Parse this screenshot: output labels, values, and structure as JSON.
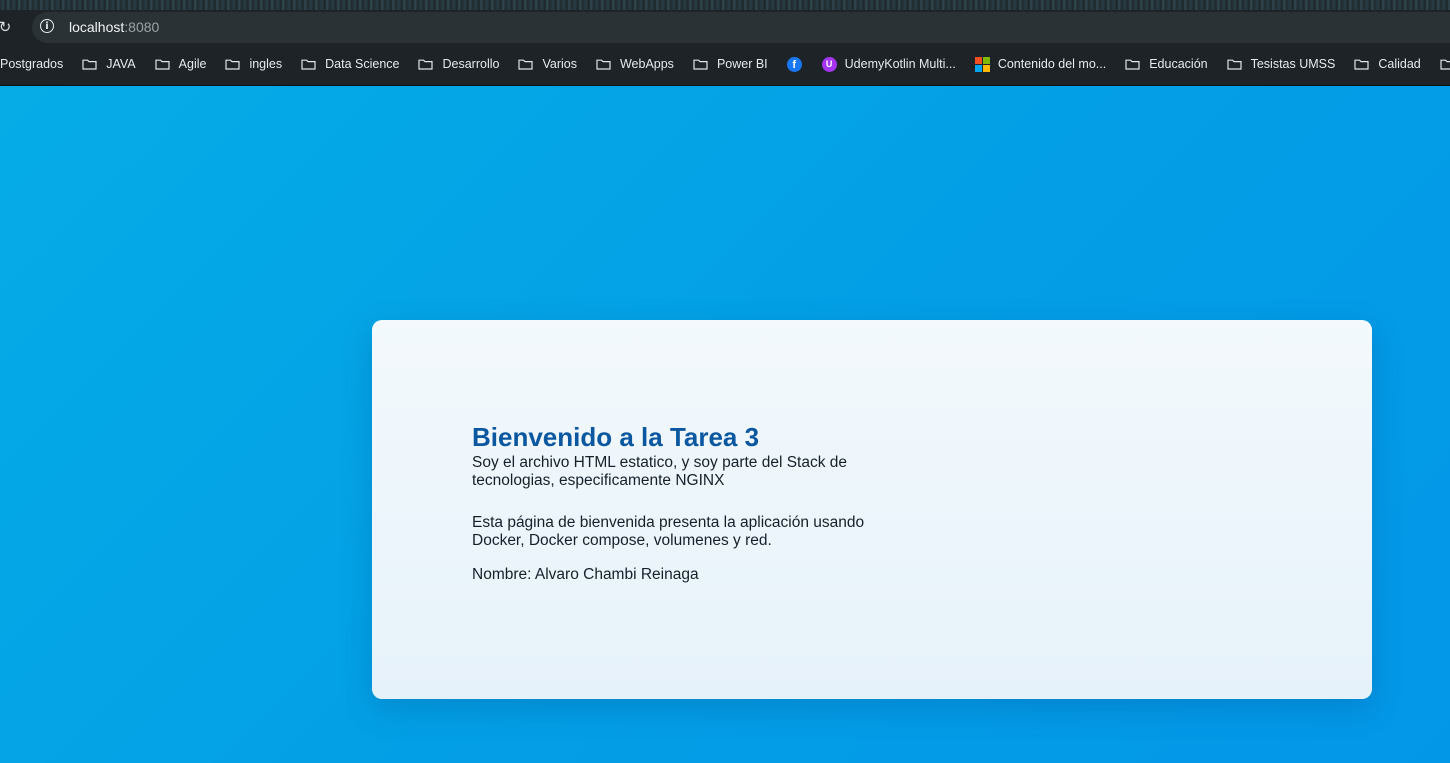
{
  "browser": {
    "url_host": "localhost",
    "url_port": ":8080",
    "bookmarks": [
      {
        "label": "Postgrados",
        "icon": "none"
      },
      {
        "label": "JAVA",
        "icon": "folder-icon"
      },
      {
        "label": "Agile",
        "icon": "folder-icon"
      },
      {
        "label": "ingles",
        "icon": "folder-icon"
      },
      {
        "label": "Data Science",
        "icon": "folder-icon"
      },
      {
        "label": "Desarrollo",
        "icon": "folder-icon"
      },
      {
        "label": "Varios",
        "icon": "folder-icon"
      },
      {
        "label": "WebApps",
        "icon": "folder-icon"
      },
      {
        "label": "Power BI",
        "icon": "folder-icon"
      },
      {
        "label": "",
        "icon": "facebook-icon"
      },
      {
        "label": "UdemyKotlin Multi...",
        "icon": "udemy-icon"
      },
      {
        "label": "Contenido del mo...",
        "icon": "microsoft-icon"
      },
      {
        "label": "Educación",
        "icon": "folder-icon"
      },
      {
        "label": "Tesistas UMSS",
        "icon": "folder-icon"
      },
      {
        "label": "Calidad",
        "icon": "folder-icon"
      },
      {
        "label": "",
        "icon": "folder-icon"
      }
    ]
  },
  "page": {
    "title": "Bienvenido a la Tarea 3",
    "paragraph1": "Soy el archivo HTML estatico, y soy parte del Stack de tecnologias, especificamente NGINX",
    "paragraph2": "Esta página de bienvenida presenta la aplicación usando Docker, Docker compose, volumenes y red.",
    "name_line": "Nombre: Alvaro Chambi Reinaga"
  },
  "colors": {
    "page_background": "#039ee6",
    "card_background": "#eef6fb",
    "title_color": "#0b57a0",
    "text_color": "#16202a"
  }
}
